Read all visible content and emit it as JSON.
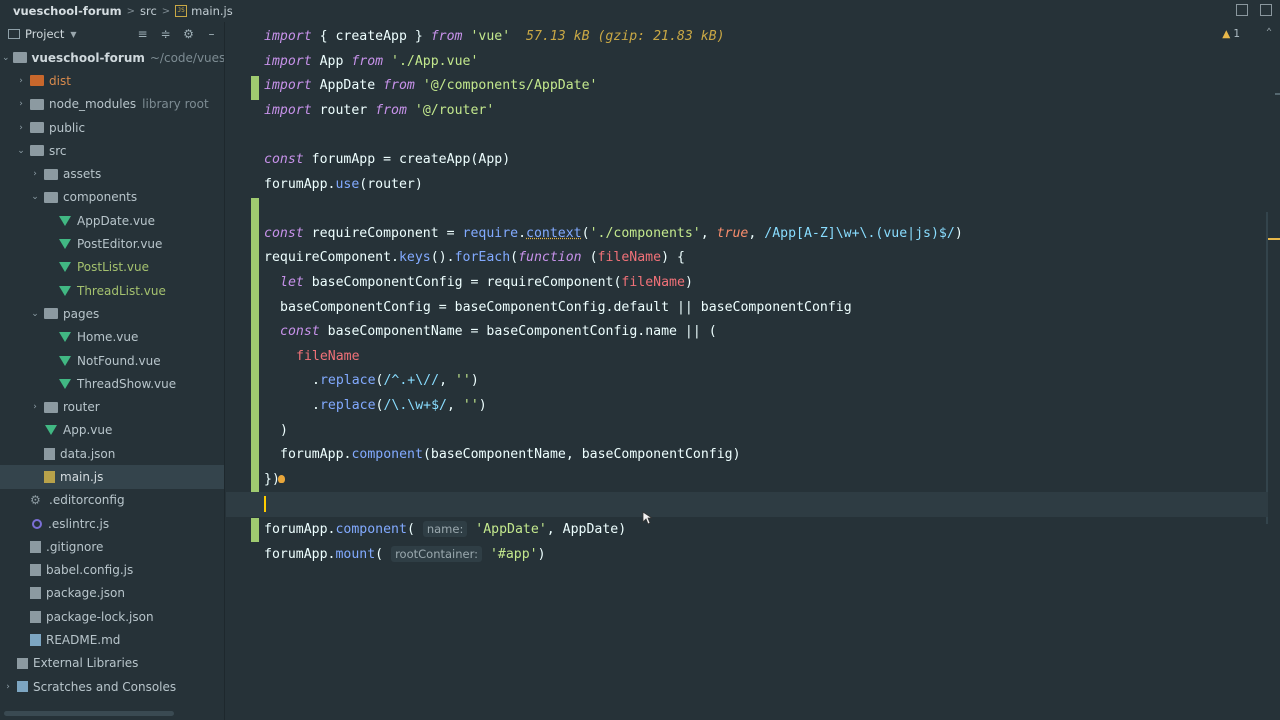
{
  "breadcrumb": {
    "project": "vueschool-forum",
    "folder": "src",
    "file": "main.js",
    "file_icon": "js-file-icon"
  },
  "sidebar": {
    "panel_title": "Project",
    "tools": [
      "collapse-all-icon",
      "expand-all-icon",
      "gear-icon",
      "minimize-icon"
    ],
    "root": {
      "label": "vueschool-forum",
      "path": "~/code/vuesch"
    },
    "items": [
      {
        "label": "dist",
        "type": "folder-excluded",
        "depth": 1,
        "expanded": false
      },
      {
        "label": "node_modules",
        "extra": "library root",
        "type": "folder",
        "depth": 1,
        "expanded": false
      },
      {
        "label": "public",
        "type": "folder",
        "depth": 1,
        "expanded": false
      },
      {
        "label": "src",
        "type": "folder",
        "depth": 1,
        "expanded": true
      },
      {
        "label": "assets",
        "type": "folder",
        "depth": 2,
        "expanded": false
      },
      {
        "label": "components",
        "type": "folder",
        "depth": 2,
        "expanded": true
      },
      {
        "label": "AppDate.vue",
        "type": "vue",
        "depth": 3
      },
      {
        "label": "PostEditor.vue",
        "type": "vue",
        "depth": 3
      },
      {
        "label": "PostList.vue",
        "type": "vue-modified",
        "depth": 3
      },
      {
        "label": "ThreadList.vue",
        "type": "vue-modified",
        "depth": 3
      },
      {
        "label": "pages",
        "type": "folder",
        "depth": 2,
        "expanded": true
      },
      {
        "label": "Home.vue",
        "type": "vue",
        "depth": 3
      },
      {
        "label": "NotFound.vue",
        "type": "vue",
        "depth": 3
      },
      {
        "label": "ThreadShow.vue",
        "type": "vue",
        "depth": 3
      },
      {
        "label": "router",
        "type": "folder",
        "depth": 2,
        "expanded": false
      },
      {
        "label": "App.vue",
        "type": "vue",
        "depth": 2
      },
      {
        "label": "data.json",
        "type": "json",
        "depth": 2
      },
      {
        "label": "main.js",
        "type": "js",
        "depth": 2,
        "selected": true
      },
      {
        "label": ".editorconfig",
        "type": "config",
        "depth": 1
      },
      {
        "label": ".eslintrc.js",
        "type": "eslint",
        "depth": 1
      },
      {
        "label": ".gitignore",
        "type": "json",
        "depth": 1
      },
      {
        "label": "babel.config.js",
        "type": "json",
        "depth": 1
      },
      {
        "label": "package.json",
        "type": "json",
        "depth": 1
      },
      {
        "label": "package-lock.json",
        "type": "json",
        "depth": 1
      },
      {
        "label": "README.md",
        "type": "md",
        "depth": 1
      }
    ],
    "external": "External Libraries",
    "scratches": "Scratches and Consoles"
  },
  "editor": {
    "warnings": {
      "icon": "warning-icon",
      "count": "1"
    },
    "import_size_hint": "57.13 kB (gzip: 21.83 kB)",
    "line1": {
      "kw": "import",
      "ident": " { createApp } ",
      "from": "from",
      "str": " 'vue'"
    },
    "line2": {
      "kw": "import",
      "ident": " App ",
      "from": "from",
      "str": " './App.vue'"
    },
    "line3": {
      "kw": "import",
      "ident": " AppDate ",
      "from": "from",
      "str": " '@/components/AppDate'"
    },
    "line4": {
      "kw": "import",
      "ident": " router ",
      "from": "from",
      "str": " '@/router'"
    },
    "line6": {
      "kw": "const",
      "rest": " forumApp = createApp(App)"
    },
    "line7": {
      "obj": "forumApp.",
      "method": "use",
      "rest": "(router)"
    },
    "line9": {
      "kw": "const",
      "a": " requireComponent = ",
      "fn": "require",
      "dot": ".",
      "ctx": "context",
      "p1": "(",
      "s1": "'./components'",
      "c1": ", ",
      "t": "true",
      "c2": ", ",
      "regex": "/App[A-Z]\\w+\\.(vue|js)$/",
      "p2": ")"
    },
    "line10": {
      "a": "requireComponent.",
      "m1": "keys",
      "b": "().",
      "m2": "forEach",
      "c": "(",
      "kw": "function",
      "d": " (",
      "param": "fileName",
      "e": ") {"
    },
    "line11": {
      "kw": "let",
      "a": " baseComponentConfig = requireComponent(",
      "param": "fileName",
      "b": ")"
    },
    "line12": {
      "text": "baseComponentConfig = baseComponentConfig.default || baseComponentConfig"
    },
    "line13": {
      "kw": "const",
      "a": " baseComponentName = baseComponentConfig.name || ("
    },
    "line14": {
      "param": "fileName"
    },
    "line15": {
      "dot": ".",
      "m": "replace",
      "a": "(",
      "regex": "/^.+\\//",
      "b": ", ",
      "s": "''",
      "c": ")"
    },
    "line16": {
      "dot": ".",
      "m": "replace",
      "a": "(",
      "regex": "/\\.\\w+$/",
      "b": ", ",
      "s": "''",
      "c": ")"
    },
    "line17": {
      "text": ")"
    },
    "line18": {
      "a": "forumApp.",
      "m": "component",
      "b": "(baseComponentName, baseComponentConfig)"
    },
    "line19": {
      "text": "})"
    },
    "line21": {
      "a": "forumApp.",
      "m": "component",
      "b": "(",
      "hint": "name:",
      "s": "'AppDate'",
      "c": ", AppDate)"
    },
    "line22": {
      "a": "forumApp.",
      "m": "mount",
      "b": "(",
      "hint": "rootContainer:",
      "s": "'#app'",
      "c": ")"
    }
  }
}
